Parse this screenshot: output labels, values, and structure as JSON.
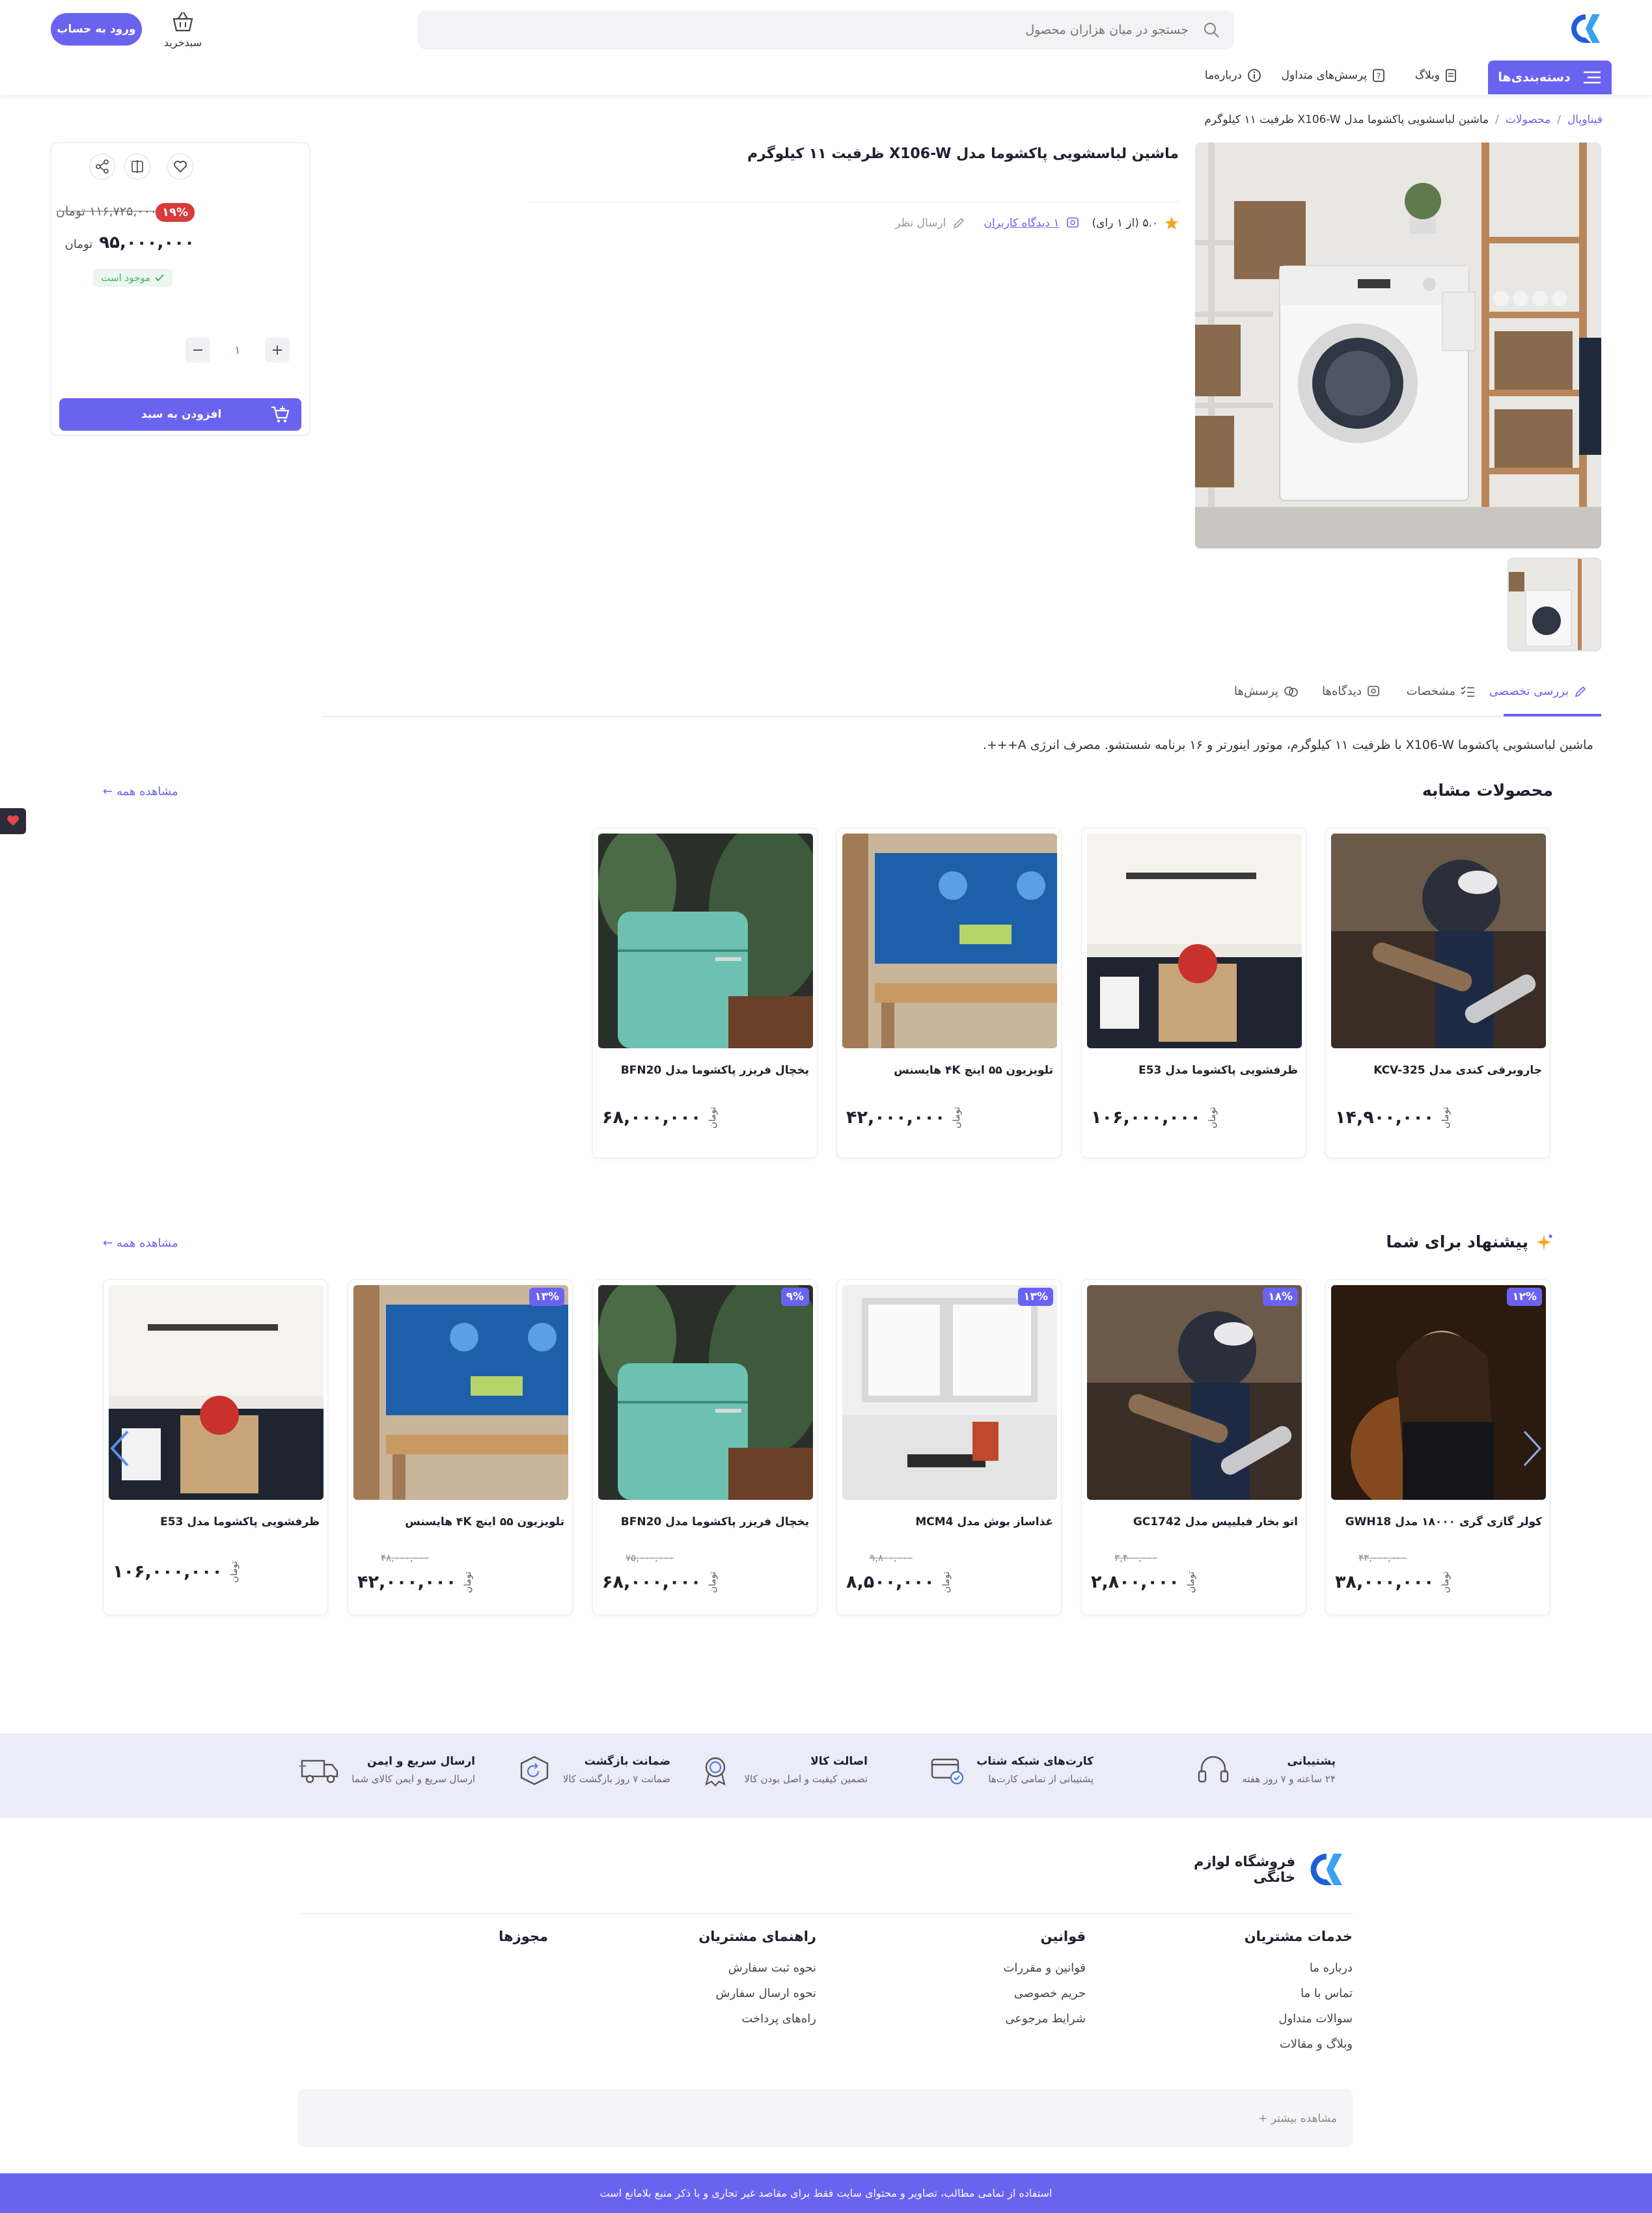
{
  "header": {
    "search_placeholder": "جستجو در میان هزاران محصول",
    "cart_label": "سبدخرید",
    "login_label": "ورود به حساب",
    "categories_label": "دسته‌بندی‌ها",
    "nav": [
      "وبلاگ",
      "پرسش‌های متداول",
      "درباره‌ما"
    ]
  },
  "breadcrumb": [
    "فیناوپال",
    "محصولات",
    "ماشین لباسشویی پاکشوما مدل X106-W ظرفیت ۱۱ کیلوگرم"
  ],
  "product": {
    "title": "ماشین لباسشویی پاکشوما مدل X106-W ظرفیت ۱۱ کیلوگرم",
    "rating": "۵.۰ (از ۱ رای)",
    "reviews_link": "۱ دیدگاه کاربران",
    "write_review": "ارسال نظر",
    "old_price": "۱۱۶,۷۲۵,۰۰۰",
    "old_price_unit": "تومان",
    "discount": "۱۹%",
    "price": "۹۵,۰۰۰,۰۰۰",
    "price_unit": "تومان",
    "stock": "موجود است",
    "quantity": "۱",
    "add_to_cart": "افزودن به سبد"
  },
  "tabs": [
    "بررسی تخصصی",
    "مشخصات",
    "دیدگاه‌ها",
    "پرسش‌ها"
  ],
  "description": "ماشین لباسشویی پاکشوما X106-W با ظرفیت ۱۱ کیلوگرم، موتور اینورتر و ۱۶ برنامه شستشو. مصرف انرژی A+++.",
  "similar": {
    "title": "محصولات مشابه",
    "see_all": "مشاهده همه ←",
    "items": [
      {
        "name": "جاروبرقی کندی مدل KCV-325",
        "price": "۱۴,۹۰۰,۰۰۰",
        "unit": "تومان"
      },
      {
        "name": "ظرفشویی پاکشوما مدل E53",
        "price": "۱۰۶,۰۰۰,۰۰۰",
        "unit": "تومان"
      },
      {
        "name": "تلویزیون ۵۵ اینچ ۴K هایسنس",
        "price": "۴۲,۰۰۰,۰۰۰",
        "unit": "تومان"
      },
      {
        "name": "یخچال فریزر پاکشوما مدل BFN20",
        "price": "۶۸,۰۰۰,۰۰۰",
        "unit": "تومان"
      }
    ]
  },
  "suggested": {
    "title": "پیشنهاد برای شما",
    "see_all": "مشاهده همه ←",
    "items": [
      {
        "name": "کولر گازی گری ۱۸۰۰۰ مدل GWH18",
        "price": "۳۸,۰۰۰,۰۰۰",
        "old": "۴۳,۰۰۰,۰۰۰",
        "disc": "۱۲%",
        "unit": "تومان"
      },
      {
        "name": "اتو بخار فیلیپس مدل GC1742",
        "price": "۲,۸۰۰,۰۰۰",
        "old": "۳,۴۰۰,۰۰۰",
        "disc": "۱۸%",
        "unit": "تومان"
      },
      {
        "name": "غذاساز بوش مدل MCM4",
        "price": "۸,۵۰۰,۰۰۰",
        "old": "۹,۸۰۰,۰۰۰",
        "disc": "۱۳%",
        "unit": "تومان"
      },
      {
        "name": "یخچال فریزر پاکشوما مدل BFN20",
        "price": "۶۸,۰۰۰,۰۰۰",
        "old": "۷۵,۰۰۰,۰۰۰",
        "disc": "۹%",
        "unit": "تومان"
      },
      {
        "name": "تلویزیون ۵۵ اینچ ۴K هایسنس",
        "price": "۴۲,۰۰۰,۰۰۰",
        "old": "۴۸,۰۰۰,۰۰۰",
        "disc": "۱۳%",
        "unit": "تومان"
      },
      {
        "name": "ظرفشویی پاکشوما مدل E53",
        "price": "۱۰۶,۰۰۰,۰۰۰",
        "unit": "تومان"
      }
    ]
  },
  "features": [
    {
      "title": "پشتیبانی",
      "sub": "۲۴ ساعته و ۷ روز هفته"
    },
    {
      "title": "کارت‌های شبکه شتاب",
      "sub": "پشتیبانی از تمامی کارت‌ها"
    },
    {
      "title": "اصالت کالا",
      "sub": "تضمین کیفیت و اصل بودن کالا"
    },
    {
      "title": "ضمانت بازگشت",
      "sub": "ضمانت ۷ روز بازگشت کالا"
    },
    {
      "title": "ارسال سریع و ایمن",
      "sub": "ارسال سریع و ایمن کالای شما"
    }
  ],
  "footer": {
    "store_name_1": "فروشگاه لوازم",
    "store_name_2": "خانگی",
    "columns": [
      {
        "title": "خدمات مشتریان",
        "links": [
          "درباره ما",
          "تماس با ما",
          "سوالات متداول",
          "وبلاگ و مقالات"
        ]
      },
      {
        "title": "قوانین",
        "links": [
          "قوانین و مقررات",
          "حریم خصوصی",
          "شرایط مرجوعی"
        ]
      },
      {
        "title": "راهنمای مشتریان",
        "links": [
          "نحوه ثبت سفارش",
          "نحوه ارسال سفارش",
          "راه‌های پرداخت"
        ]
      },
      {
        "title": "مجوزها",
        "links": []
      }
    ],
    "see_more": "مشاهده بیشتر +",
    "copyright": "استفاده از تمامی مطالب، تصاویر و محتوای سایت فقط برای مقاصد غیر تجاری و با ذکر منبع بلامانع است"
  },
  "colors": {
    "accent": "#6a63f0",
    "discount_red": "#d93a3a",
    "feature_band": "#ececf8",
    "stock_green": "#4caf6a"
  }
}
